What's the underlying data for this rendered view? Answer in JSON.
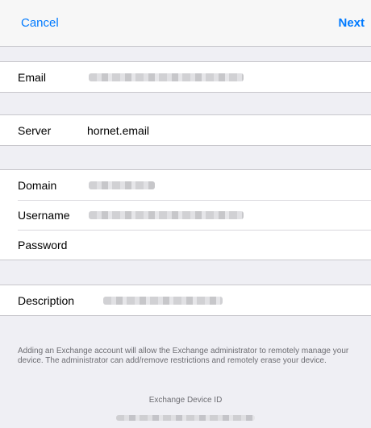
{
  "nav": {
    "cancel_label": "Cancel",
    "next_label": "Next"
  },
  "fields": {
    "email_label": "Email",
    "server_label": "Server",
    "server_value": "hornet.email",
    "domain_label": "Domain",
    "username_label": "Username",
    "password_label": "Password",
    "description_label": "Description"
  },
  "footer": {
    "note": "Adding an Exchange account will allow the Exchange administrator to remotely manage your device. The administrator can add/remove restrictions and remotely erase your device.",
    "device_id_label": "Exchange Device ID"
  },
  "colors": {
    "accent": "#007aff",
    "background": "#efeff4",
    "secondary_text": "#6d6d72"
  }
}
